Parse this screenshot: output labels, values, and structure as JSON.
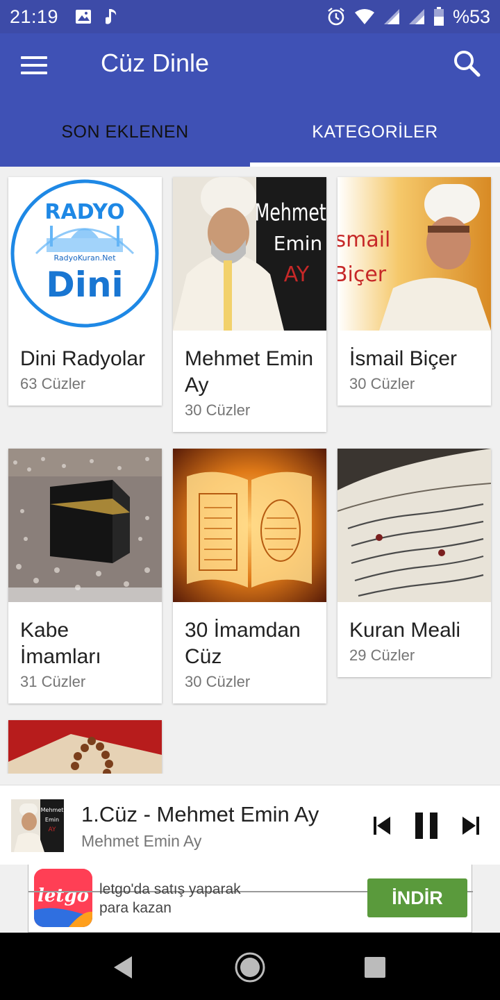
{
  "status_bar": {
    "time": "21:19",
    "battery": "%53",
    "left_icons": [
      "image-icon",
      "music-note-icon"
    ],
    "right_icons": [
      "alarm-icon",
      "wifi-icon",
      "signal-icon",
      "signal-icon",
      "battery-icon"
    ]
  },
  "app_bar": {
    "title": "Cüz Dinle",
    "color": "#3f51b5"
  },
  "tabs": [
    {
      "label": "SON EKLENEN",
      "active": false
    },
    {
      "label": "KATEGORİLER",
      "active": true
    }
  ],
  "categories": [
    {
      "title": "Dini Radyolar",
      "count": "63 Cüzler",
      "logo_text_top": "RADYO",
      "logo_text_mid": "RadyoKuran.Net",
      "logo_text_big": "Dini"
    },
    {
      "title": "Mehmet Emin Ay",
      "count": "30 Cüzler",
      "image_text": [
        "Mehmet",
        "Emin",
        "AY"
      ]
    },
    {
      "title": "İsmail Biçer",
      "count": "30 Cüzler",
      "image_text": [
        "İsmail",
        "Biçer"
      ]
    },
    {
      "title": "Kabe İmamları",
      "count": "31 Cüzler"
    },
    {
      "title": "30 İmamdan Cüz",
      "count": "30 Cüzler"
    },
    {
      "title": "Kuran Meali",
      "count": "29 Cüzler"
    },
    {
      "title": "",
      "count": ""
    }
  ],
  "player": {
    "title": "1.Cüz - Mehmet Emin Ay",
    "artist": "Mehmet Emin Ay",
    "thumb_text": [
      "Mehmet",
      "Emin",
      "AY"
    ]
  },
  "ad": {
    "brand": "letgo",
    "text": "letgo'da satış yaparak para kazan",
    "cta": "İNDİR",
    "cta_color": "#5a9a3c"
  }
}
